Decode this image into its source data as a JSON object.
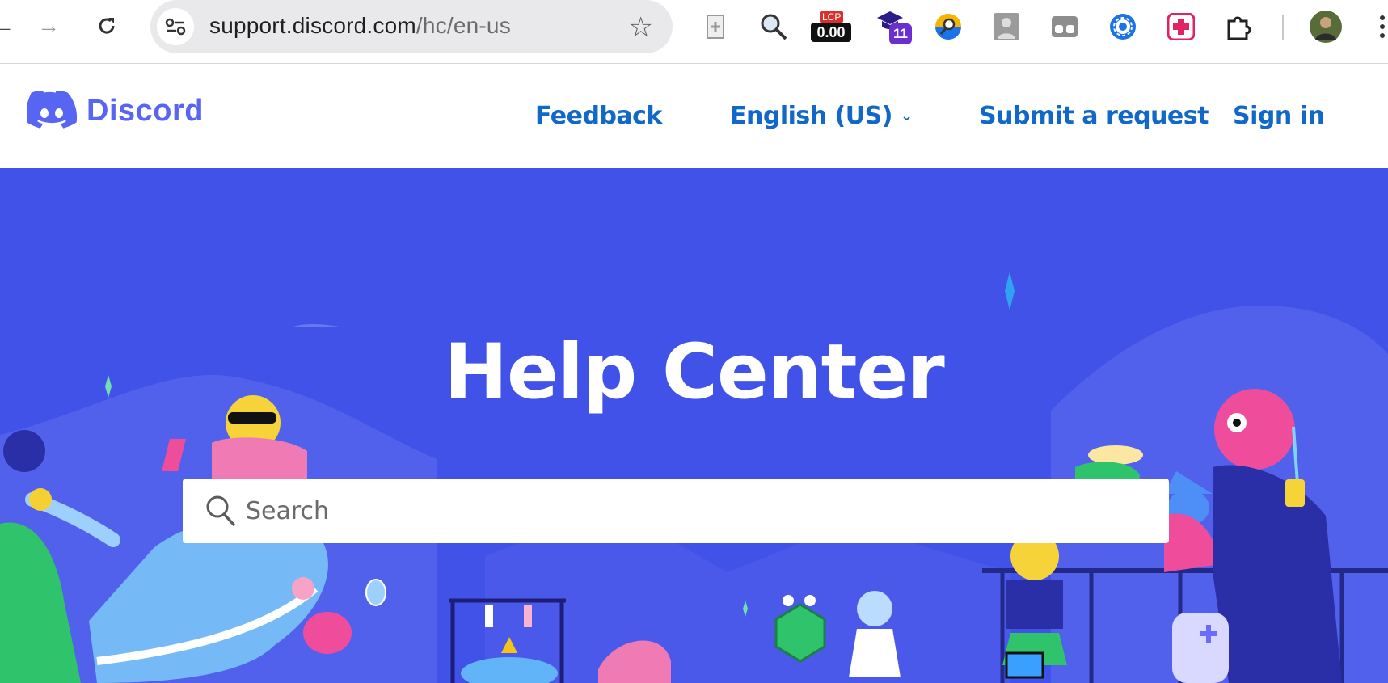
{
  "browser": {
    "url_host": "support.discord.com",
    "url_path": "/hc/en-us",
    "extensions": {
      "lcp_label": "LCP",
      "lcp_value": "0.00",
      "badge_count": "11"
    }
  },
  "header": {
    "logo_text": "Discord",
    "nav": {
      "feedback": "Feedback",
      "language": "English (US)",
      "submit": "Submit a request",
      "signin": "Sign in"
    }
  },
  "hero": {
    "title": "Help Center",
    "search_placeholder": "Search"
  },
  "colors": {
    "brand": "#5865f2",
    "hero_bg": "#4052e8",
    "link": "#1168c9"
  }
}
